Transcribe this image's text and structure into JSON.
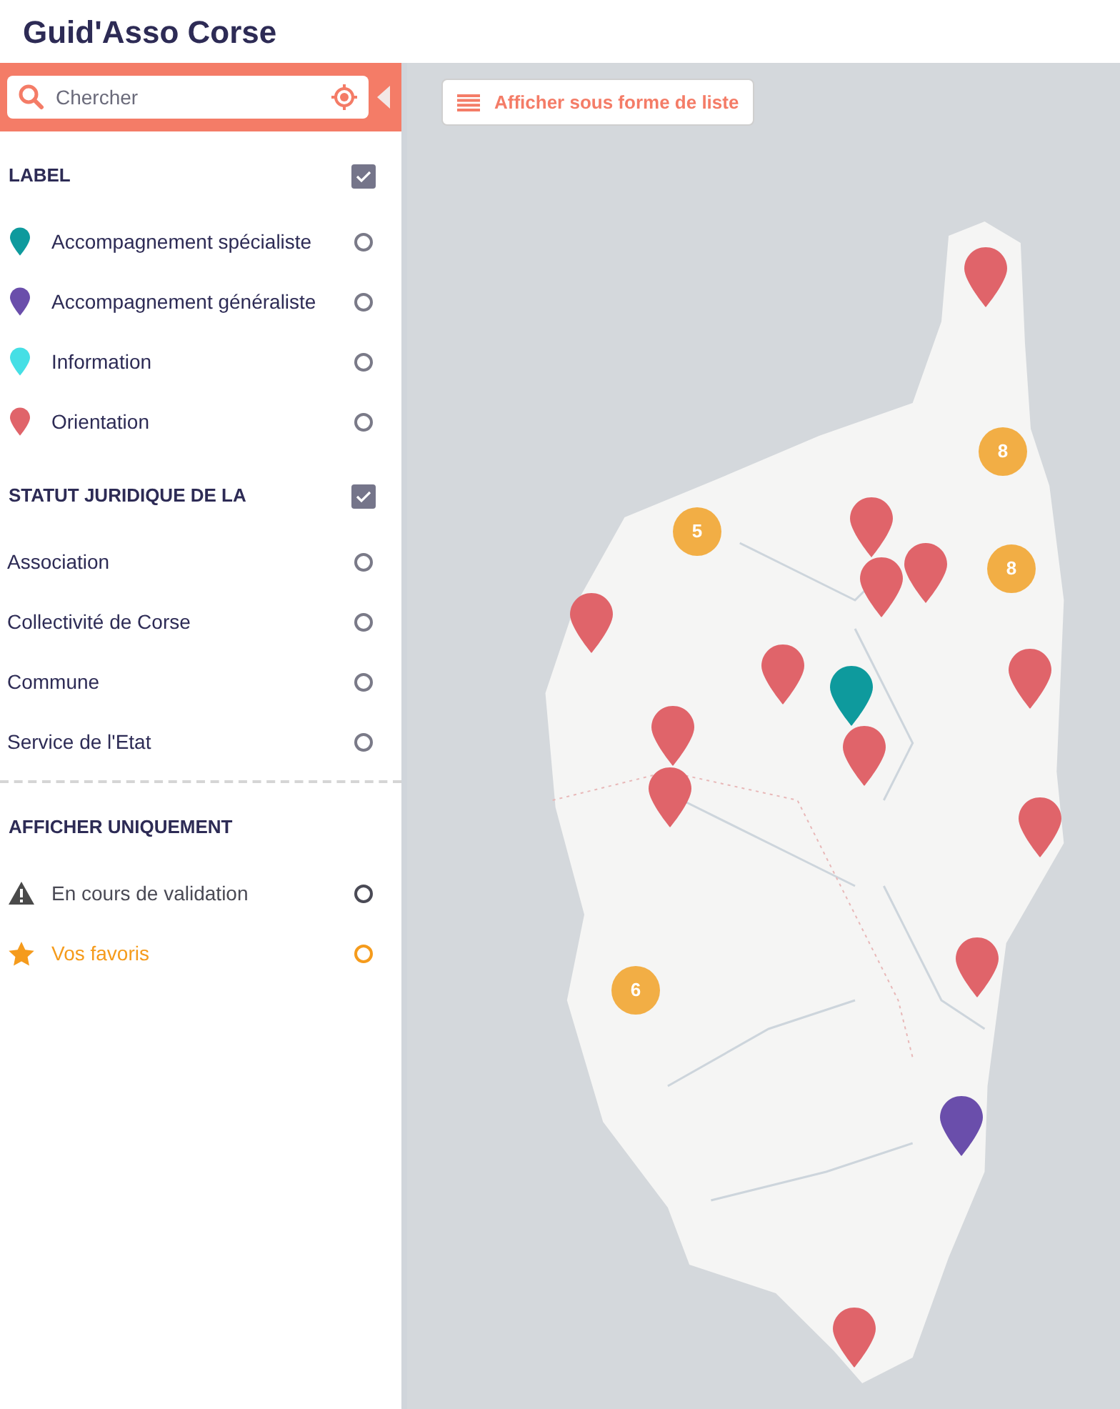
{
  "app_title": "Guid'Asso Corse",
  "search": {
    "placeholder": "Chercher"
  },
  "list_button": {
    "label": "Afficher sous forme de liste"
  },
  "sections": [
    {
      "title": "LABEL",
      "checked": true,
      "items": [
        {
          "label": "Accompagnement spécialiste",
          "kind": "pin",
          "color": "#0e9a9d",
          "selected": false
        },
        {
          "label": "Accompagnement généraliste",
          "kind": "pin",
          "color": "#6a4eab",
          "selected": false
        },
        {
          "label": "Information",
          "kind": "pin",
          "color": "#45dfe5",
          "selected": false
        },
        {
          "label": "Orientation",
          "kind": "pin",
          "color": "#e0646a",
          "selected": false
        }
      ]
    },
    {
      "title": "STATUT JURIDIQUE DE LA",
      "checked": true,
      "items": [
        {
          "label": "Association",
          "kind": "plain",
          "selected": false
        },
        {
          "label": "Collectivité de Corse",
          "kind": "plain",
          "selected": false
        },
        {
          "label": "Commune",
          "kind": "plain",
          "selected": false
        },
        {
          "label": "Service de l'Etat",
          "kind": "plain",
          "selected": false
        }
      ]
    },
    {
      "title": "AFFICHER UNIQUEMENT",
      "items": [
        {
          "label": "En cours de validation",
          "kind": "warning",
          "selected": false
        },
        {
          "label": "Vos favoris",
          "kind": "favorite",
          "selected": false
        }
      ]
    }
  ],
  "markers": [
    {
      "color": "#e0646a"
    },
    {
      "color": "#e0646a"
    },
    {
      "color": "#e0646a"
    },
    {
      "color": "#e0646a"
    },
    {
      "color": "#e0646a"
    },
    {
      "color": "#e0646a"
    },
    {
      "color": "#0e9a9d"
    },
    {
      "color": "#e0646a"
    },
    {
      "color": "#e0646a"
    },
    {
      "color": "#e0646a"
    },
    {
      "color": "#e0646a"
    },
    {
      "color": "#e0646a"
    },
    {
      "color": "#e0646a"
    },
    {
      "color": "#6a4eab"
    },
    {
      "color": "#e0646a"
    }
  ],
  "clusters": [
    {
      "count": "5"
    },
    {
      "count": "8"
    },
    {
      "count": "8"
    },
    {
      "count": "6"
    }
  ]
}
